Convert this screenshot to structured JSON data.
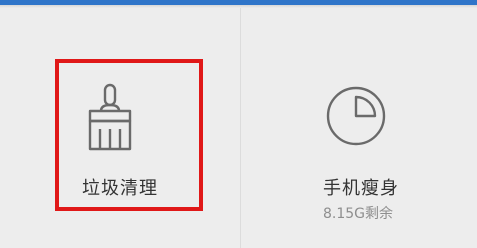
{
  "top_bar": {
    "color": "#2f75c9"
  },
  "tiles": {
    "junk_clean": {
      "label": "垃圾清理",
      "icon": "broom-icon",
      "highlight_color": "#e01818"
    },
    "phone_slim": {
      "label": "手机瘦身",
      "sublabel": "8.15G剩余",
      "icon": "storage-pie-icon"
    }
  }
}
